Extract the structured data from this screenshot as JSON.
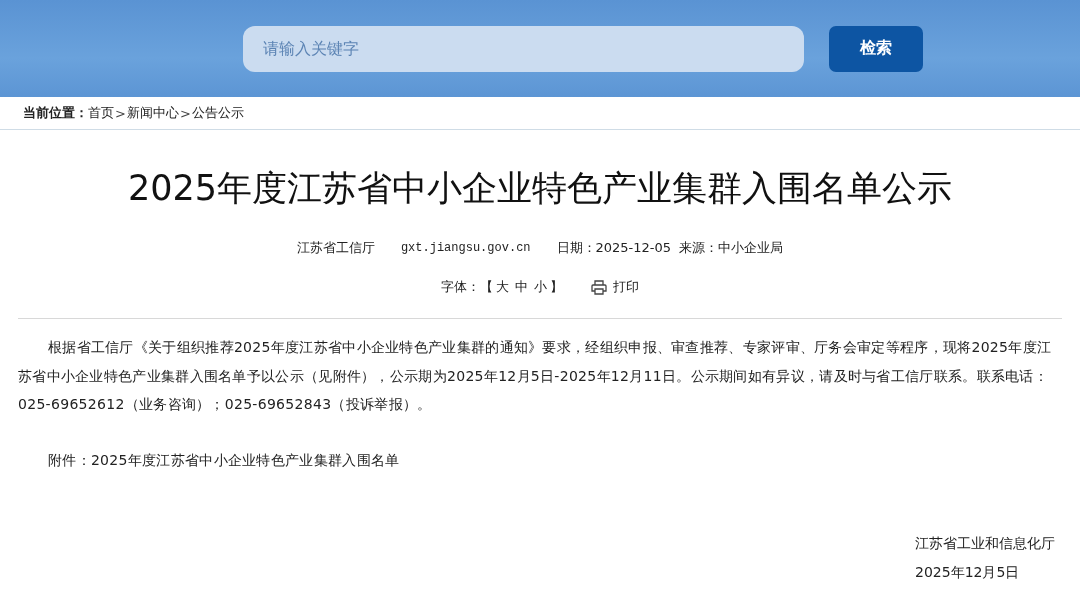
{
  "search": {
    "placeholder": "请输入关键字",
    "button": "检索"
  },
  "breadcrumb": {
    "label": "当前位置：",
    "parts": [
      {
        "kind": "link",
        "text": "首页"
      },
      {
        "kind": "sep",
        "text": ">"
      },
      {
        "kind": "link",
        "text": "新闻中心"
      },
      {
        "kind": "sep",
        "text": ">"
      },
      {
        "kind": "link",
        "text": "公告公示"
      }
    ]
  },
  "article": {
    "title": "2025年度江苏省中小企业特色产业集群入围名单公示",
    "meta": {
      "publisher": "江苏省工信厅",
      "site": "gxt.jiangsu.gov.cn",
      "date": "日期：2025-12-05",
      "source": "来源：中小企业局"
    },
    "font_size": {
      "label": "字体：",
      "open": "【",
      "options": [
        "大",
        "中",
        "小"
      ],
      "close": "】"
    },
    "print": "打印",
    "paragraphs": [
      "根据省工信厅《关于组织推荐2025年度江苏省中小企业特色产业集群的通知》要求，经组织申报、审查推荐、专家评审、厅务会审定等程序，现将2025年度江苏省中小企业特色产业集群入围名单予以公示（见附件），公示期为2025年12月5日-2025年12月11日。公示期间如有异议，请及时与省工信厅联系。联系电话：025-69652612（业务咨询）；025-69652843（投诉举报）。",
      "附件：2025年度江苏省中小企业特色产业集群入围名单"
    ],
    "signature": [
      "江苏省工业和信息化厅",
      "2025年12月5日"
    ]
  }
}
